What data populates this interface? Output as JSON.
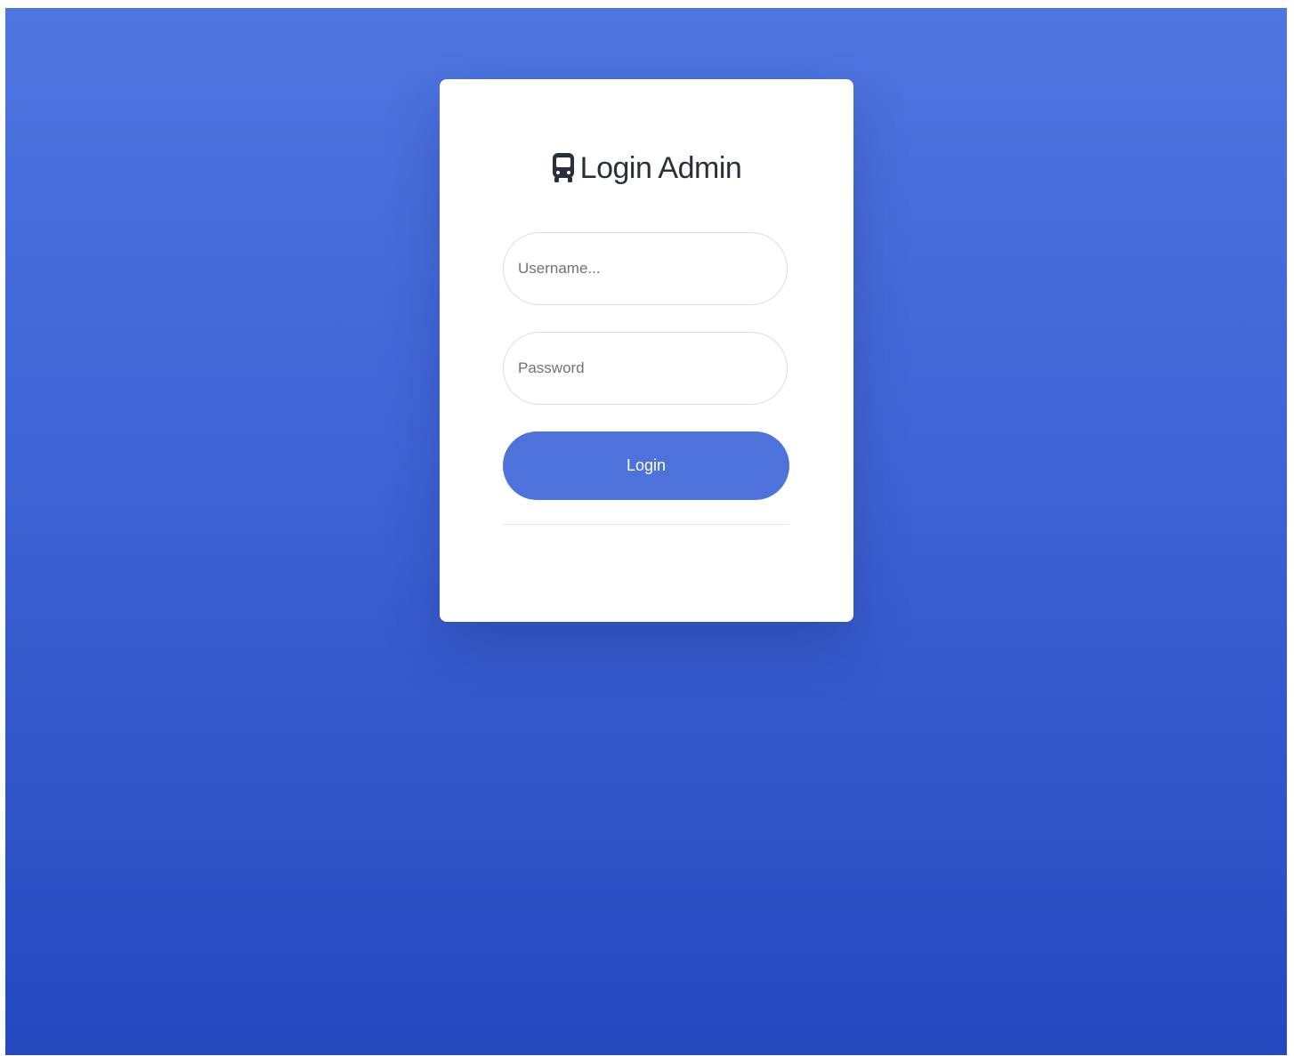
{
  "login": {
    "title": "Login Admin",
    "title_icon": "bus-icon",
    "username_placeholder": "Username...",
    "password_placeholder": "Password",
    "button_label": "Login"
  },
  "colors": {
    "background_top": "#4e75e0",
    "background_bottom": "#2449bf",
    "button": "#4e72dc",
    "card": "#ffffff"
  }
}
